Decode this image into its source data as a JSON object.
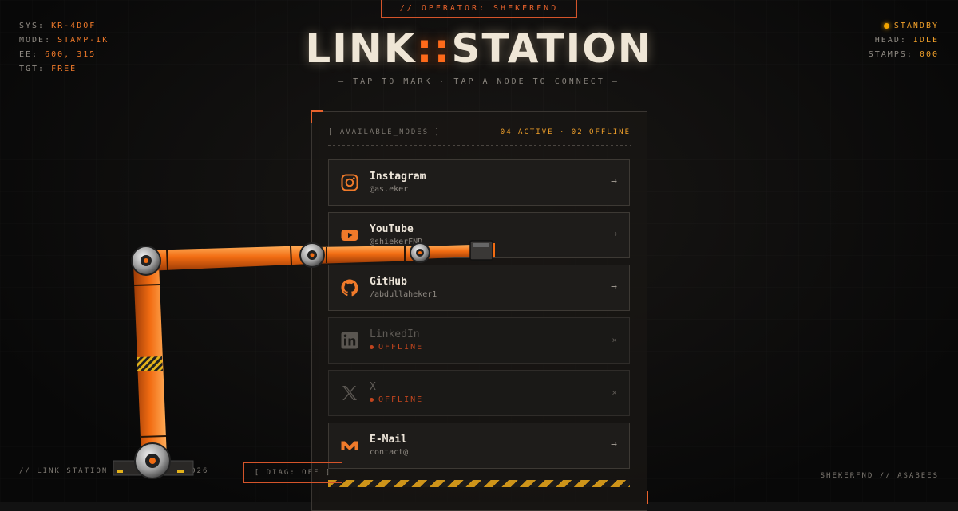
{
  "operator": "// OPERATOR: SHEKERFND",
  "title": {
    "left": "LINK",
    "sep": "::",
    "right": "STATION"
  },
  "subtitle": "— TAP TO MARK · TAP A NODE TO CONNECT —",
  "hud_left": [
    {
      "key": "SYS:",
      "value": "KR-4DOF"
    },
    {
      "key": "MODE:",
      "value": "STAMP-IK"
    },
    {
      "key": "EE:",
      "value": "600, 315"
    },
    {
      "key": "TGT:",
      "value": "FREE"
    }
  ],
  "hud_right": [
    {
      "key": "",
      "value": "STANDBY"
    },
    {
      "key": "HEAD:",
      "value": "IDLE"
    },
    {
      "key": "STAMPS:",
      "value": "000"
    }
  ],
  "panel": {
    "label": "[ AVAILABLE_NODES ]",
    "status": "04 ACTIVE · 02 OFFLINE",
    "nodes": [
      {
        "name": "Instagram",
        "handle": "@as.eker",
        "icon": "instagram-icon",
        "state": "active",
        "action": "→"
      },
      {
        "name": "YouTube",
        "handle": "@shiekerFND",
        "icon": "youtube-icon",
        "state": "active",
        "action": "→"
      },
      {
        "name": "GitHub",
        "handle": "/abdullaheker1",
        "icon": "github-icon",
        "state": "active",
        "action": "→"
      },
      {
        "name": "LinkedIn",
        "handle": "OFFLINE",
        "icon": "linkedin-icon",
        "state": "offline",
        "action": "×"
      },
      {
        "name": "X",
        "handle": "OFFLINE",
        "icon": "x-icon",
        "state": "offline",
        "action": "×"
      },
      {
        "name": "E-Mail",
        "handle": "contact@",
        "icon": "mail-icon",
        "state": "active",
        "action": "→"
      }
    ]
  },
  "footer": {
    "left": "// LINK_STATION_v1.1 // EST.2026",
    "diag": "[ DIAG: OFF ]",
    "right": "SHEKERFND // ASABEES"
  },
  "colors": {
    "accent": "#ff6a1a",
    "amber": "#f2a12a",
    "offline": "#c2451e",
    "background": "#121212"
  }
}
